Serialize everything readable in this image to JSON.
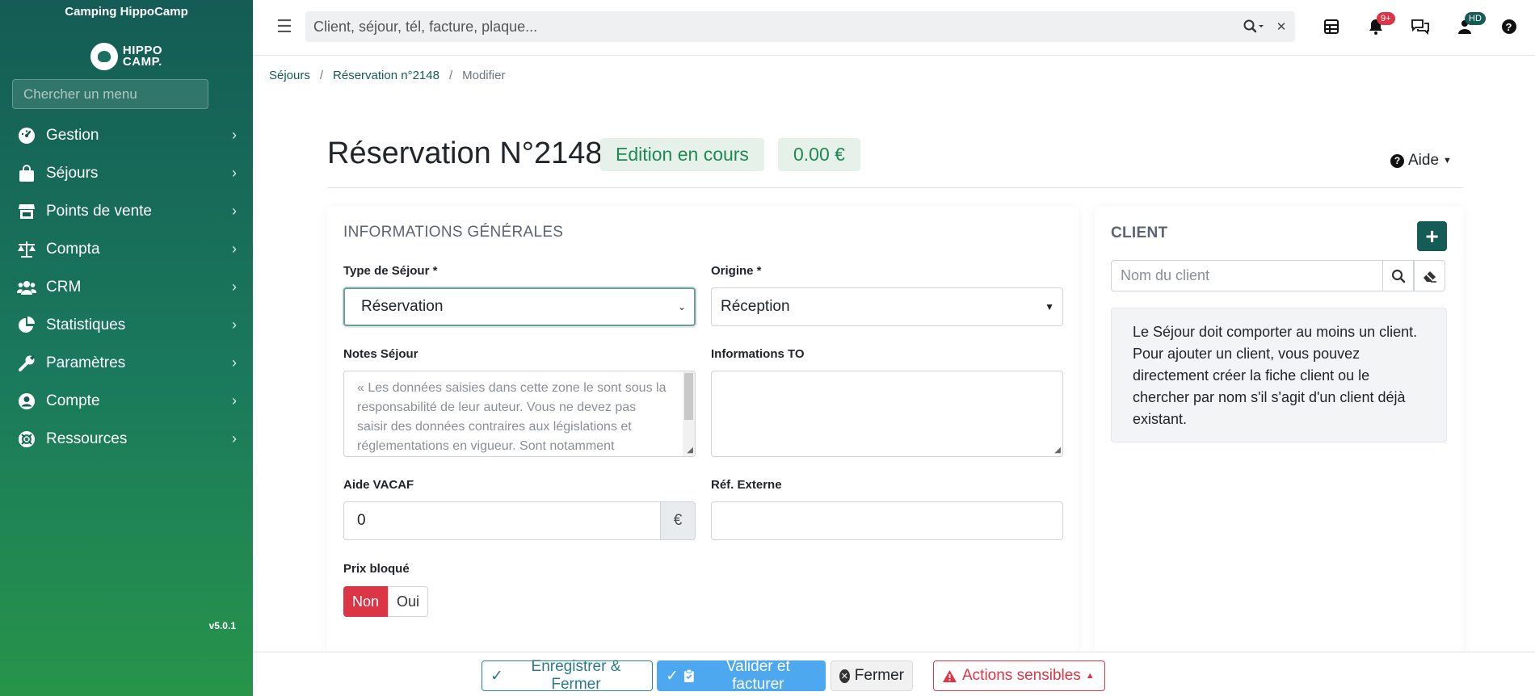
{
  "app": {
    "camping_name": "Camping HippoCamp",
    "logo_text_1": "HIPPO",
    "logo_text_2": "CAMP.",
    "version": "v5.0.1"
  },
  "sidebar": {
    "search_placeholder": "Chercher un menu",
    "items": [
      {
        "label": "Gestion",
        "icon": "dashboard-icon"
      },
      {
        "label": "Séjours",
        "icon": "shopping-bag-icon"
      },
      {
        "label": "Points de vente",
        "icon": "store-icon"
      },
      {
        "label": "Compta",
        "icon": "scale-icon"
      },
      {
        "label": "CRM",
        "icon": "users-icon"
      },
      {
        "label": "Statistiques",
        "icon": "pie-chart-icon"
      },
      {
        "label": "Paramètres",
        "icon": "wrench-icon"
      },
      {
        "label": "Compte",
        "icon": "user-circle-icon"
      },
      {
        "label": "Ressources",
        "icon": "lifebuoy-icon"
      }
    ]
  },
  "topbar": {
    "search_placeholder": "Client, séjour, tél, facture, plaque...",
    "notifications_badge": "9+",
    "user_badge": "HD"
  },
  "breadcrumb": {
    "level1": "Séjours",
    "level2": "Réservation n°2148",
    "level3": "Modifier",
    "separator": "/"
  },
  "header": {
    "title": "Réservation N°2148",
    "status": "Edition en cours",
    "amount": "0.00 €",
    "help_label": "Aide"
  },
  "general": {
    "heading": "INFORMATIONS GÉNÉRALES",
    "type_label": "Type de Séjour *",
    "type_value": "Réservation",
    "origin_label": "Origine *",
    "origin_value": "Réception",
    "notes_label": "Notes Séjour",
    "notes_placeholder": "« Les données saisies dans cette zone le sont sous la responsabilité de leur auteur. Vous ne devez pas saisir des données contraires aux législations et réglementations en vigueur. Sont notamment",
    "to_label": "Informations TO",
    "vacaf_label": "Aide VACAF",
    "vacaf_value": "0",
    "vacaf_currency": "€",
    "ref_label": "Réf. Externe",
    "ref_value": "",
    "price_locked_label": "Prix bloqué",
    "price_locked_no": "Non",
    "price_locked_yes": "Oui",
    "price_locked_selected": "Non"
  },
  "client": {
    "heading": "CLIENT",
    "name_placeholder": "Nom du client",
    "info": "Le Séjour doit comporter au moins un client. Pour ajouter un client, vous pouvez directement créer la fiche client ou le chercher par nom s'il s'agit d'un client déjà existant."
  },
  "footer": {
    "save_close": "Enregistrer & Fermer",
    "validate_invoice": "Valider et facturer",
    "close": "Fermer",
    "sensitive_actions": "Actions sensibles"
  },
  "colors": {
    "brand": "#145c55",
    "danger": "#dc3545",
    "primary": "#4ea8f0",
    "success_text": "#1f8a52"
  }
}
